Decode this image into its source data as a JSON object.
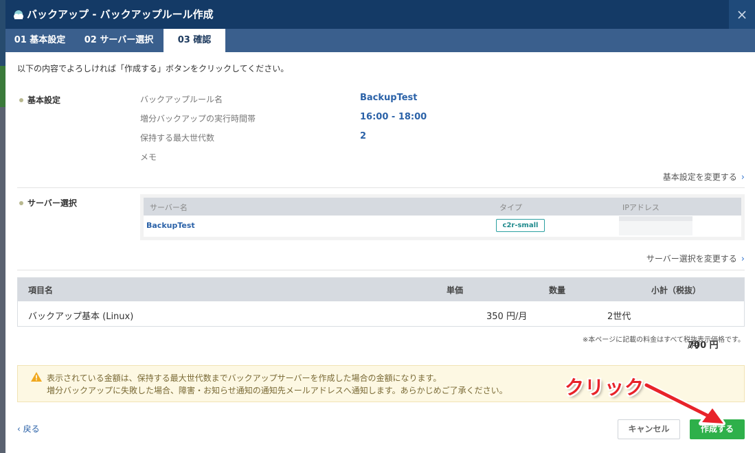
{
  "window": {
    "title": "バックアップ - バックアップルール作成",
    "close_icon": "×"
  },
  "tabs": [
    {
      "label": "01 基本設定",
      "active": false
    },
    {
      "label": "02 サーバー選択",
      "active": false
    },
    {
      "label": "03 確認",
      "active": true
    }
  ],
  "intro": "以下の内容でよろしければ「作成する」ボタンをクリックしてください。",
  "basic": {
    "section_label": "基本設定",
    "rows": [
      {
        "label": "バックアップルール名",
        "value": "BackupTest"
      },
      {
        "label": "増分バックアップの実行時間帯",
        "value": "16:00 - 18:00"
      },
      {
        "label": "保持する最大世代数",
        "value": "2"
      },
      {
        "label": "メモ",
        "value": ""
      }
    ],
    "change_link": "基本設定を変更する"
  },
  "server": {
    "section_label": "サーバー選択",
    "columns": [
      "サーバー名",
      "タイプ",
      "IPアドレス"
    ],
    "rows": [
      {
        "name": "BackupTest",
        "type": "c2r-small"
      }
    ],
    "change_link": "サーバー選択を変更する"
  },
  "pricing": {
    "columns": [
      "項目名",
      "単価",
      "数量",
      "小計（税抜）"
    ],
    "rows": [
      {
        "item": "バックアップ基本 (Linux)",
        "unit_price": "350 円/月",
        "quantity": "2世代",
        "subtotal": "700 円",
        "subtotal_unit": "/月"
      }
    ],
    "tax_note": "※本ページに記載の料金はすべて税抜表示価格です。"
  },
  "notice": {
    "line1": "表示されている金額は、保持する最大世代数までバックアップサーバーを作成した場合の金額になります。",
    "line2": "増分バックアップに失敗した場合、障害・お知らせ通知の通知先メールアドレスへ通知します。あらかじめご了承ください。"
  },
  "footer": {
    "back": "戻る",
    "cancel": "キャンセル",
    "create": "作成する"
  },
  "annotation": {
    "text": "クリック"
  },
  "colors": {
    "titlebar": "#143a66",
    "tabs": "#3a5f8d",
    "link": "#2b62a8",
    "subtotal": "#c8266d",
    "create_button": "#2eb04a",
    "annotation": "#e8232a"
  }
}
